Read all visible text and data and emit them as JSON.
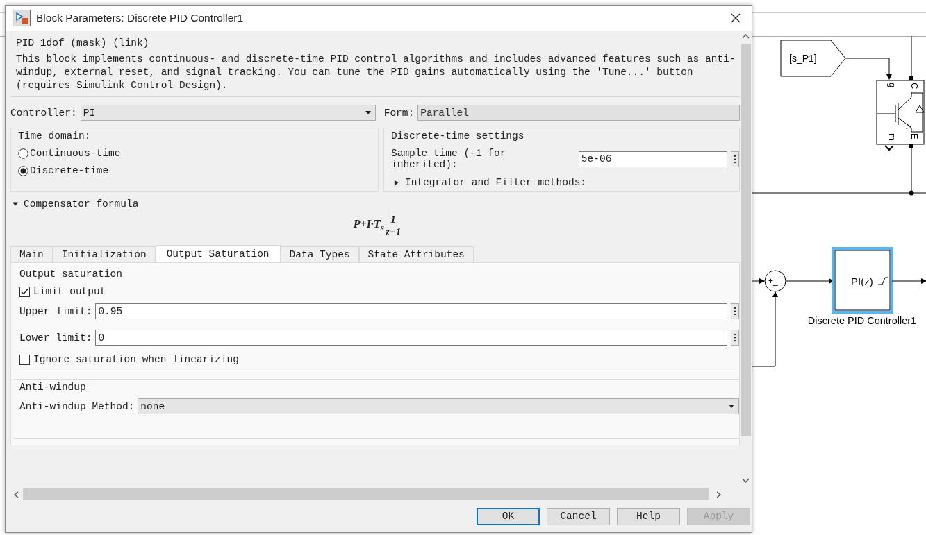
{
  "window": {
    "title": "Block Parameters: Discrete PID Controller1"
  },
  "mask": {
    "title": "PID 1dof (mask) (link)",
    "description": "This block implements continuous- and discrete-time PID control algorithms and includes advanced features such as anti-windup, external reset, and signal tracking. You can tune the PID gains automatically using the 'Tune...' button (requires Simulink Control Design)."
  },
  "controller": {
    "label": "Controller:",
    "value": "PI"
  },
  "form": {
    "label": "Form:",
    "value": "Parallel",
    "disabled": true
  },
  "time_domain": {
    "title": "Time domain:",
    "options": [
      {
        "label": "Continuous-time",
        "selected": false
      },
      {
        "label": "Discrete-time",
        "selected": true
      }
    ]
  },
  "discrete_settings": {
    "title": "Discrete-time settings",
    "sample_time": {
      "label": "Sample time (-1 for inherited):",
      "value": "5e-06"
    },
    "methods": {
      "label": "Integrator and Filter methods:",
      "expanded": false
    }
  },
  "compensator": {
    "label": "Compensator formula",
    "expanded": true,
    "formula": {
      "expression": "P+I·T$_{s}$",
      "numerator": "1",
      "denominator": "z−1"
    }
  },
  "tabs": [
    {
      "label": "Main",
      "selected": false
    },
    {
      "label": "Initialization",
      "selected": false
    },
    {
      "label": "Output Saturation",
      "selected": true
    },
    {
      "label": "Data Types",
      "selected": false
    },
    {
      "label": "State Attributes",
      "selected": false
    }
  ],
  "output_saturation": {
    "title": "Output saturation",
    "limit_output": {
      "label": "Limit output",
      "checked": true
    },
    "upper_limit": {
      "label": "Upper limit:",
      "value": "0.95"
    },
    "lower_limit": {
      "label": "Lower limit:",
      "value": "0"
    },
    "ignore_saturation": {
      "label": "Ignore saturation when linearizing",
      "checked": false
    }
  },
  "anti_windup": {
    "title": "Anti-windup",
    "method": {
      "label": "Anti-windup Method:",
      "value": "none"
    }
  },
  "buttons": [
    {
      "label": "OK",
      "default": true,
      "disabled": false
    },
    {
      "label": "Cancel",
      "default": false,
      "disabled": false
    },
    {
      "label": "Help",
      "default": false,
      "disabled": false
    },
    {
      "label": "Apply",
      "default": false,
      "disabled": true
    }
  ],
  "diagram": {
    "goto_tag": "[s_P1]",
    "igbt_ports": [
      "g",
      "C",
      "m",
      "E"
    ],
    "sum_signs": "+_",
    "pid_block": {
      "text": "PI(z)",
      "name": "Discrete PID Controller1",
      "selected": true
    }
  }
}
